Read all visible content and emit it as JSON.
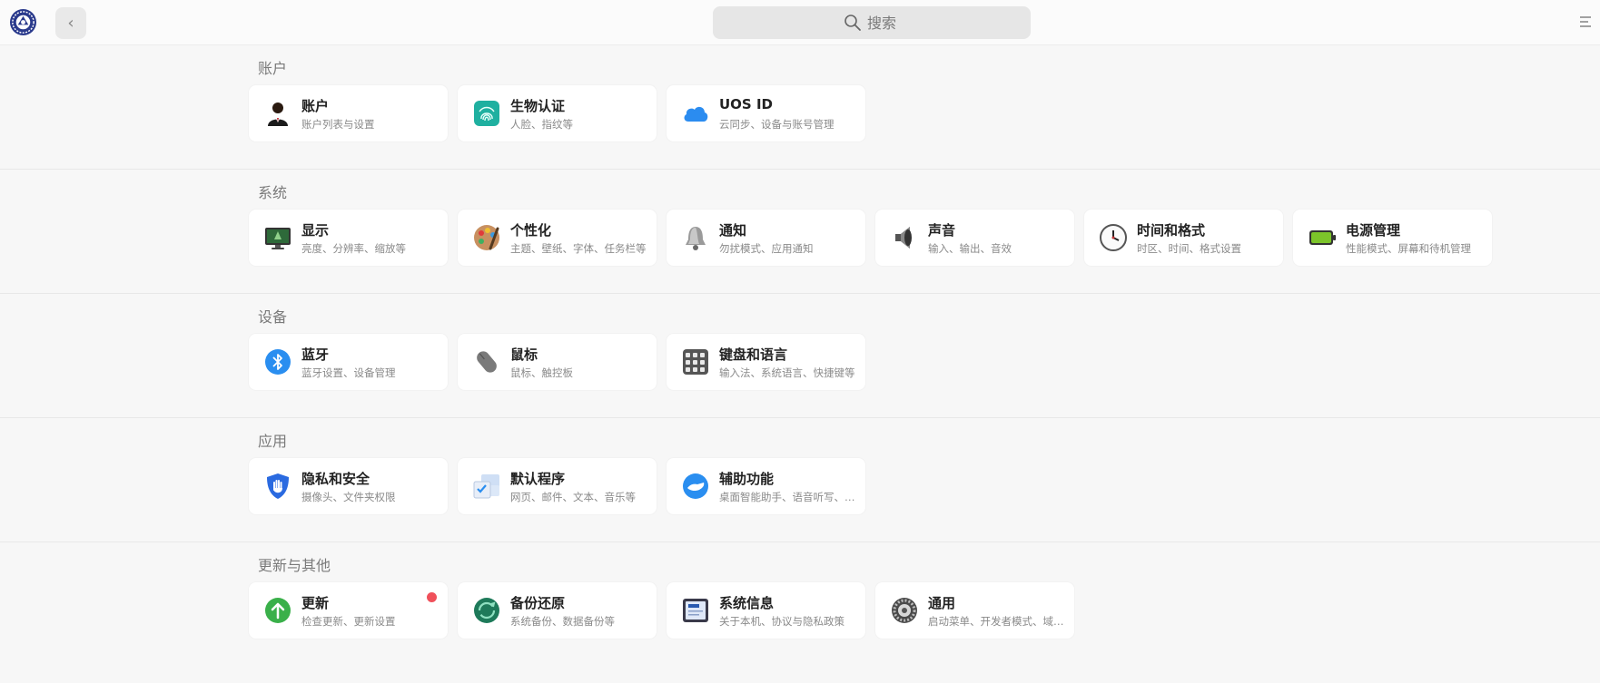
{
  "search": {
    "placeholder": "搜索"
  },
  "sections": [
    {
      "title": "账户",
      "items": [
        {
          "name": "账户",
          "desc": "账户列表与设置",
          "icon": "user-avatar-icon"
        },
        {
          "name": "生物认证",
          "desc": "人脸、指纹等",
          "icon": "fingerprint-icon"
        },
        {
          "name": "UOS ID",
          "desc": "云同步、设备与账号管理",
          "icon": "cloud-icon"
        }
      ]
    },
    {
      "title": "系统",
      "items": [
        {
          "name": "显示",
          "desc": "亮度、分辨率、缩放等",
          "icon": "monitor-icon"
        },
        {
          "name": "个性化",
          "desc": "主题、壁纸、字体、任务栏等",
          "icon": "palette-icon"
        },
        {
          "name": "通知",
          "desc": "勿扰模式、应用通知",
          "icon": "bell-icon"
        },
        {
          "name": "声音",
          "desc": "输入、输出、音效",
          "icon": "speaker-icon"
        },
        {
          "name": "时间和格式",
          "desc": "时区、时间、格式设置",
          "icon": "clock-icon"
        },
        {
          "name": "电源管理",
          "desc": "性能模式、屏幕和待机管理",
          "icon": "battery-icon"
        }
      ]
    },
    {
      "title": "设备",
      "items": [
        {
          "name": "蓝牙",
          "desc": "蓝牙设置、设备管理",
          "icon": "bluetooth-icon"
        },
        {
          "name": "鼠标",
          "desc": "鼠标、触控板",
          "icon": "mouse-icon"
        },
        {
          "name": "键盘和语言",
          "desc": "输入法、系统语言、快捷键等",
          "icon": "keyboard-icon"
        }
      ]
    },
    {
      "title": "应用",
      "items": [
        {
          "name": "隐私和安全",
          "desc": "摄像头、文件夹权限",
          "icon": "shield-icon"
        },
        {
          "name": "默认程序",
          "desc": "网页、邮件、文本、音乐等",
          "icon": "default-apps-icon"
        },
        {
          "name": "辅助功能",
          "desc": "桌面智能助手、语音听写、语…",
          "icon": "accessibility-icon"
        }
      ]
    },
    {
      "title": "更新与其他",
      "items": [
        {
          "name": "更新",
          "desc": "检查更新、更新设置",
          "icon": "update-arrow-icon",
          "badge": true
        },
        {
          "name": "备份还原",
          "desc": "系统备份、数据备份等",
          "icon": "backup-icon"
        },
        {
          "name": "系统信息",
          "desc": "关于本机、协议与隐私政策",
          "icon": "system-info-icon"
        },
        {
          "name": "通用",
          "desc": "启动菜单、开发者模式、域管…",
          "icon": "gear-icon"
        }
      ]
    }
  ]
}
